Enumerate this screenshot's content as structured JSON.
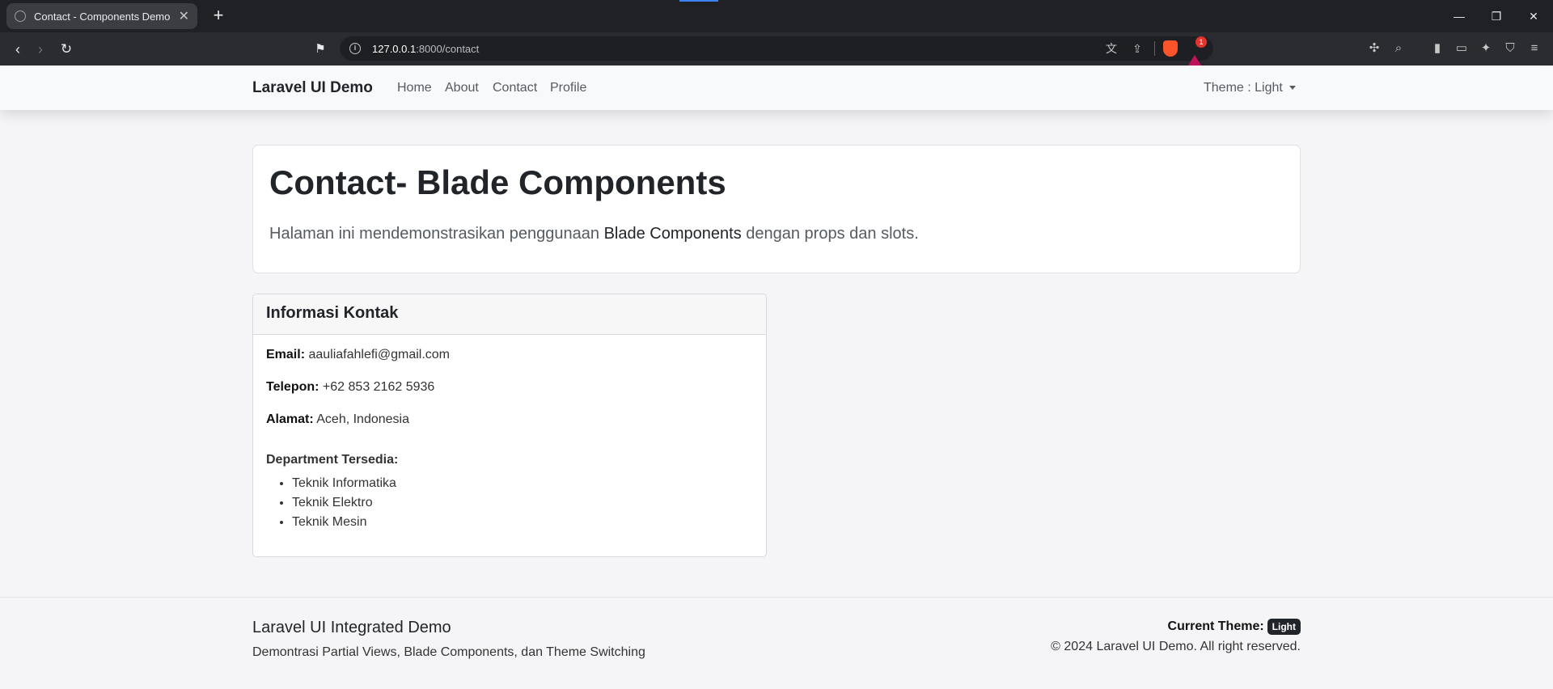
{
  "browser": {
    "tab_title": "Contact - Components Demo",
    "new_tab_icon": "+",
    "url_host": "127.0.0.1",
    "url_path": ":8000/contact",
    "notification_count": "1"
  },
  "navbar": {
    "brand": "Laravel UI Demo",
    "links": [
      "Home",
      "About",
      "Contact",
      "Profile"
    ],
    "theme_label": "Theme : Light"
  },
  "hero": {
    "title": "Contact- Blade Components",
    "desc_before": "Halaman ini mendemonstrasikan penggunaan ",
    "desc_strong": "Blade Components",
    "desc_after": " dengan props dan slots."
  },
  "contact_card": {
    "header": "Informasi Kontak",
    "email_label": "Email:",
    "email_value": " aauliafahlefi@gmail.com",
    "phone_label": "Telepon:",
    "phone_value": " +62 853 2162 5936",
    "address_label": "Alamat:",
    "address_value": " Aceh, Indonesia",
    "dept_title": "Department Tersedia:",
    "departments": [
      "Teknik Informatika",
      "Teknik Elektro",
      "Teknik Mesin"
    ]
  },
  "footer": {
    "title": "Laravel UI Integrated Demo",
    "subtitle": "Demontrasi Partial Views, Blade Components, dan Theme Switching",
    "current_theme_label": "Current Theme:",
    "current_theme_value": "Light",
    "copyright": "© 2024 Laravel UI Demo. All right reserved."
  },
  "colors": {
    "navbar_bg": "#f8f9fa",
    "page_bg": "#f5f5f7",
    "badge_bg": "#212529"
  }
}
